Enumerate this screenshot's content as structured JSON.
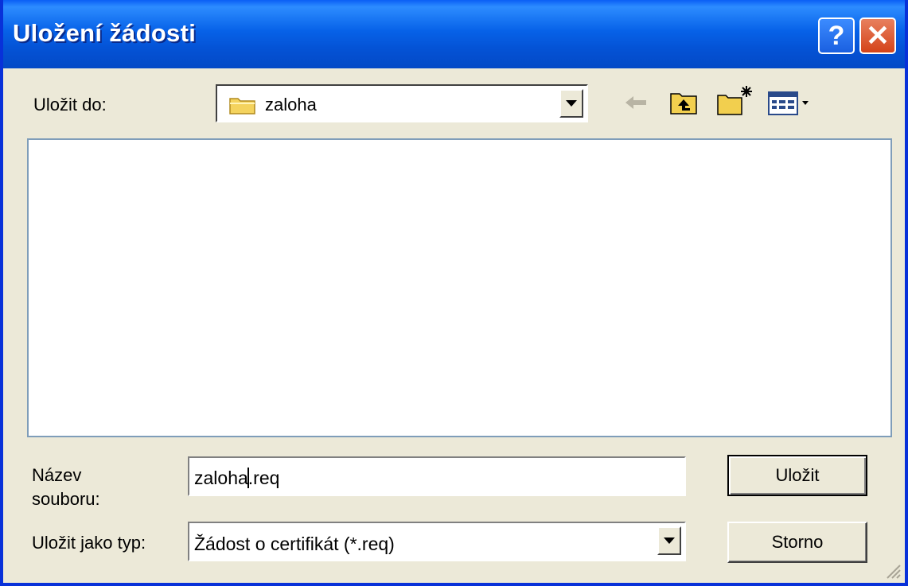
{
  "window": {
    "title": "Uložení žádosti"
  },
  "title_buttons": {
    "help": "?",
    "close": "✕"
  },
  "save_in": {
    "label": "Uložit do:",
    "value": "zaloha"
  },
  "file_name": {
    "label_line1": "Název",
    "label_line2": "souboru:",
    "value_before_caret": "zaloha",
    "value_after_caret": ".req"
  },
  "save_type": {
    "label": "Uložit jako typ:",
    "value": "Žádost o certifikát (*.req)"
  },
  "buttons": {
    "save": "Uložit",
    "cancel": "Storno"
  },
  "icons": {
    "folder": "folder-icon",
    "back": "back-arrow-icon",
    "up": "up-folder-icon",
    "new_folder": "new-folder-icon",
    "views": "views-menu-icon"
  },
  "colors": {
    "title_bar": "#0453d6",
    "dialog_bg": "#ece9d8",
    "close_button": "#d4431a"
  }
}
